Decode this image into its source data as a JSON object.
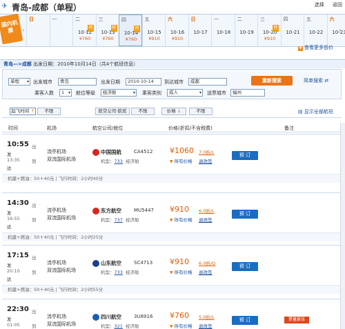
{
  "header": {
    "title": "青岛-成都（单程）",
    "links": [
      "选择",
      "返回"
    ]
  },
  "date_bar": {
    "logo_text": "国内机票",
    "days": [
      {
        "weekday": "日",
        "date": "",
        "price": "",
        "weekend": true
      },
      {
        "weekday": "一",
        "date": "",
        "price": "",
        "weekend": false
      },
      {
        "weekday": "二",
        "date": "10-12",
        "price": "¥760",
        "weekend": false,
        "tag": "特"
      },
      {
        "weekday": "三",
        "date": "10-13",
        "price": "¥760",
        "weekend": false,
        "tag": "特"
      },
      {
        "weekday": "四",
        "date": "10-14",
        "price": "¥760",
        "weekend": false,
        "tag": "特",
        "selected": true
      },
      {
        "weekday": "五",
        "date": "10-15",
        "price": "¥910",
        "weekend": false
      },
      {
        "weekday": "六",
        "date": "10-16",
        "price": "¥910",
        "weekend": true
      },
      {
        "weekday": "日",
        "date": "10-17",
        "price": "",
        "weekend": true
      },
      {
        "weekday": "一",
        "date": "10-18",
        "price": "",
        "weekend": false
      },
      {
        "weekday": "二",
        "date": "10-19",
        "price": "",
        "weekend": false
      },
      {
        "weekday": "三",
        "date": "10-20",
        "price": "¥910",
        "weekend": false,
        "tag": "特"
      },
      {
        "weekday": "四",
        "date": "10-21",
        "price": "",
        "weekend": false
      },
      {
        "weekday": "五",
        "date": "10-22",
        "price": "",
        "weekend": false
      },
      {
        "weekday": "六",
        "date": "10-23",
        "price": "",
        "weekend": true
      }
    ],
    "more_price": "查看更多低价"
  },
  "route": {
    "text": "青岛—>成都",
    "detail": "出发日期：2010年10月14日（共4个航班信息）"
  },
  "search": {
    "trip_type": "单程",
    "from_label": "出发城市",
    "from_value": "青岛",
    "date_label": "出发日期",
    "date_value": "2010-10-14",
    "to_label": "到达城市",
    "to_value": "成都",
    "passengers_label": "乘客人数",
    "passengers_value": "1",
    "cabin_label": "舱位等级",
    "cabin_value": "经济舱",
    "ptype_label": "乘客类别",
    "ptype_value": "成人",
    "delivery_label": "送票城市",
    "delivery_value": "福州",
    "search_button": "重新搜索",
    "simple_search": "简单搜索"
  },
  "filters": {
    "time_label": "起飞时间",
    "time_value": "不限",
    "airline_label": "航空公司·航班",
    "airline_value": "不限",
    "price_label": "价格",
    "price_value": "不限",
    "show_all": "显示全部航班"
  },
  "columns": [
    "时间",
    "机场",
    "航空公司/舱位",
    "价格(折扣/不含税费)",
    "备注"
  ],
  "flights": [
    {
      "dep_time": "10:55",
      "dep_tag": "出",
      "dep_sub": "发",
      "arr_time": "13:35",
      "arr_tag": "到",
      "arr_sub": "达",
      "dep_airport": "流亭机场",
      "arr_airport": "双流国际机场",
      "airline": "中国国航",
      "flight_no": "CA4512",
      "model_label": "机型：",
      "model": "733",
      "cabin": "经济舱",
      "price": "¥1060",
      "discount": "7.0折/L",
      "all_prices": "所有价格",
      "refund": "退改签",
      "book": "预 订",
      "tax": "机建+燃油：50＋40元 | 飞行时间：2小时40分",
      "icon_color": "#d8261c"
    },
    {
      "dep_time": "14:30",
      "dep_tag": "出",
      "dep_sub": "发",
      "arr_time": "16:55",
      "arr_tag": "到",
      "arr_sub": "达",
      "dep_airport": "流亭机场",
      "arr_airport": "双流国际机场",
      "airline": "东方航空",
      "flight_no": "MU5447",
      "model_label": "机型：",
      "model": "737",
      "cabin": "经济舱",
      "price": "¥910",
      "discount": "6.0折/L",
      "all_prices": "所有价格",
      "refund": "退改签",
      "book": "预 订",
      "tax": "机建+燃油：50＋40元 | 飞行时间：2小时25分",
      "icon_color": "#d8261c"
    },
    {
      "dep_time": "17:15",
      "dep_tag": "出",
      "dep_sub": "发",
      "arr_time": "20:10",
      "arr_tag": "到",
      "arr_sub": "达",
      "dep_airport": "流亭机场",
      "arr_airport": "双流国际机场",
      "airline": "山东航空",
      "flight_no": "SC4713",
      "model_label": "机型：",
      "model": "733",
      "cabin": "经济舱",
      "price": "¥910",
      "discount": "6.0折/Q",
      "all_prices": "所有价格",
      "refund": "退改签",
      "book": "预 订",
      "tax": "机建+燃油：50＋40元 | 飞行时间：2小时55分",
      "icon_color": "#1a3f8c"
    },
    {
      "dep_time": "22:30",
      "dep_tag": "出",
      "dep_sub": "发",
      "arr_time": "01:05",
      "arr_tag": "到",
      "arr_sub": "",
      "dep_airport": "流亭机场",
      "arr_airport": "双流国际机场",
      "airline": "四川航空",
      "flight_no": "3U8916",
      "model_label": "机型：",
      "model": "321",
      "cabin": "经济舱",
      "price": "¥760",
      "discount": "5.0折/L",
      "all_prices": "所有价格",
      "refund": "退改签",
      "book": "预 订",
      "badge": "票量紧张",
      "icon_color": "#1a5fb4"
    }
  ]
}
